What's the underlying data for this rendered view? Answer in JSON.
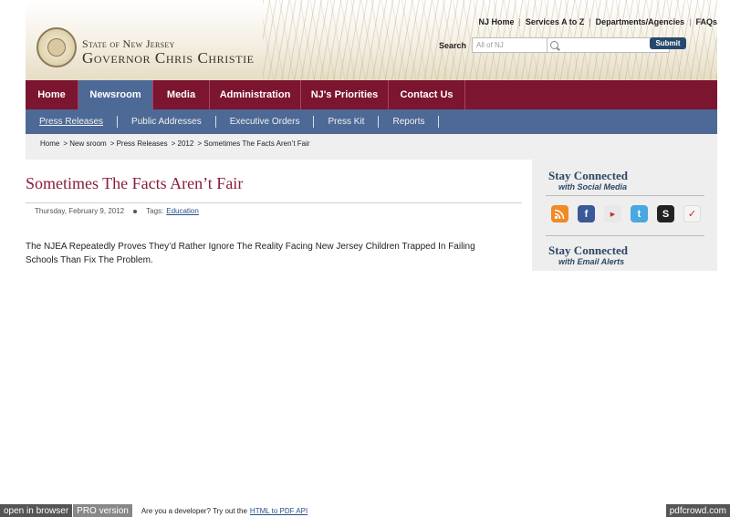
{
  "header": {
    "brand_line1": "State of New Jersey",
    "brand_line2": "Governor Chris Christie",
    "util_links": [
      "NJ Home",
      "Services A to Z",
      "Departments/Agencies",
      "FAQs"
    ],
    "search_label": "Search",
    "search_scope": "All of NJ",
    "search_value": "",
    "submit_label": "Submit"
  },
  "mainnav": {
    "tabs": [
      {
        "label": "Home",
        "active": false
      },
      {
        "label": "Newsroom",
        "active": true
      },
      {
        "label": "Media",
        "active": false
      },
      {
        "label": "Administration",
        "active": false
      },
      {
        "label": "NJ's Priorities",
        "active": false
      },
      {
        "label": "Contact Us",
        "active": false
      }
    ]
  },
  "subnav": {
    "items": [
      {
        "label": "Press Releases",
        "active": true
      },
      {
        "label": "Public Addresses",
        "active": false
      },
      {
        "label": "Executive Orders",
        "active": false
      },
      {
        "label": "Press Kit",
        "active": false
      },
      {
        "label": "Reports",
        "active": false
      }
    ]
  },
  "breadcrumb": [
    "Home",
    "> New sroom",
    "> Press Releases",
    "> 2012",
    "> Sometimes The Facts Aren’t Fair"
  ],
  "article": {
    "title": "Sometimes The Facts Aren’t Fair",
    "date": "Thursday, February 9, 2012",
    "tags_label": "Tags:",
    "tag": "Education",
    "lede": "The NJEA Repeatedly Proves They’d Rather Ignore The Reality Facing New Jersey Children Trapped In Failing Schools Than Fix The Problem."
  },
  "sidebar": {
    "social_heading": "Stay Connected",
    "social_sub": "with Social Media",
    "email_heading": "Stay Connected",
    "email_sub": "with Email Alerts",
    "icons": [
      "rss-icon",
      "facebook-icon",
      "youtube-icon",
      "twitter-icon",
      "scribd-icon",
      "flickr-icon"
    ]
  },
  "footer": {
    "open_label": "open in browser",
    "pro_label": "PRO version",
    "dev_text": "Are you a developer? Try out the",
    "api_link": "HTML to PDF API",
    "brand": "pdfcrowd.com"
  }
}
